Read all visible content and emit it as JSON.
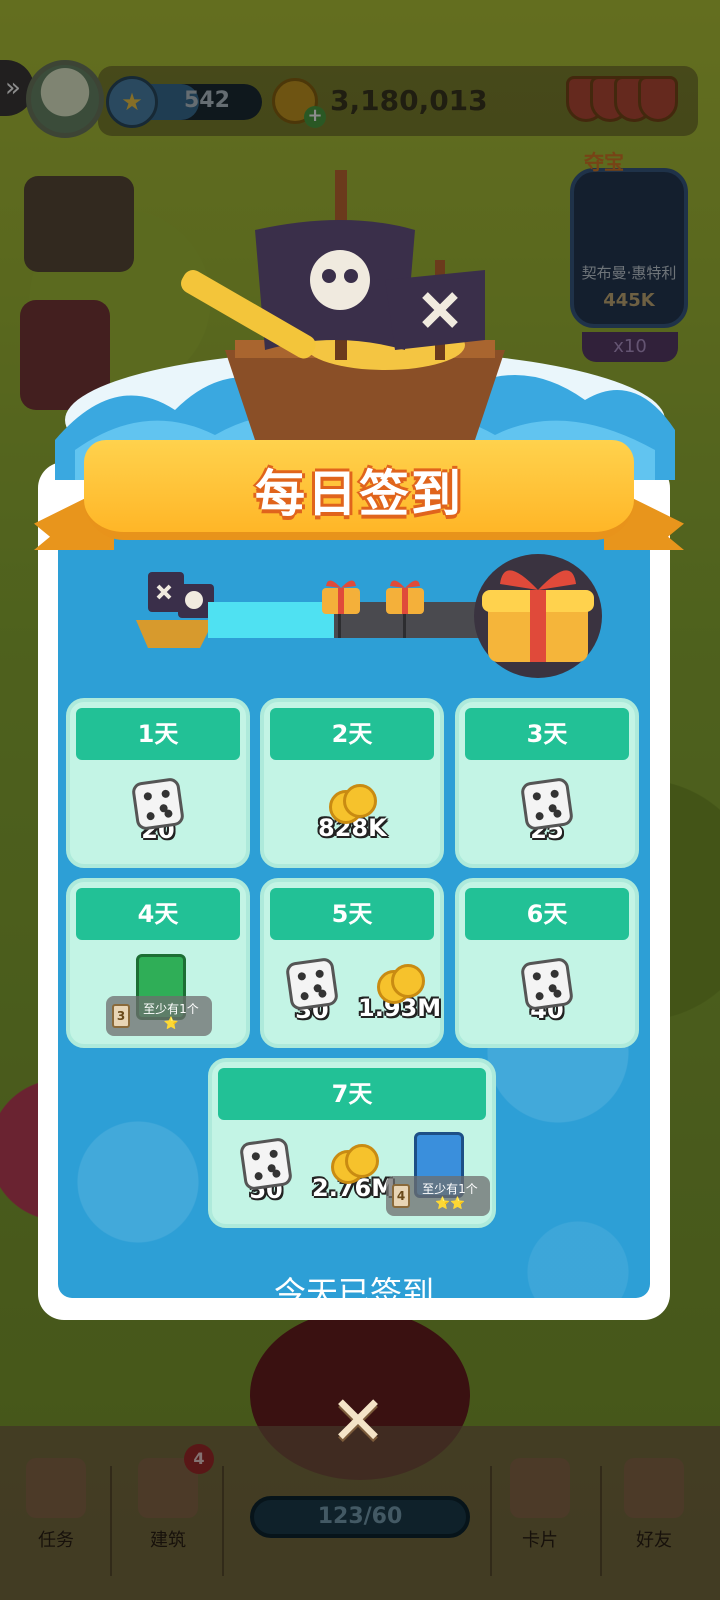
{
  "hud": {
    "level": "542",
    "coins": "3,180,013"
  },
  "side": {
    "right_title": "夺宝",
    "right_name": "契布曼·惠特利",
    "right_value": "445K",
    "right_multiplier": "x10"
  },
  "popup": {
    "title": "每日签到",
    "progress_fraction": 0.45,
    "days": [
      {
        "label": "1天",
        "rewards": [
          {
            "type": "dice",
            "amount": "20"
          }
        ]
      },
      {
        "label": "2天",
        "rewards": [
          {
            "type": "coins",
            "amount": "828K"
          }
        ]
      },
      {
        "label": "3天",
        "rewards": [
          {
            "type": "dice",
            "amount": "25"
          }
        ]
      },
      {
        "label": "4天",
        "rewards": [
          {
            "type": "card-pack",
            "pack_count": "3",
            "pack_text": "至少有1个",
            "stars": "⭐"
          }
        ]
      },
      {
        "label": "5天",
        "rewards": [
          {
            "type": "dice",
            "amount": "30"
          },
          {
            "type": "coins",
            "amount": "1.93M"
          }
        ]
      },
      {
        "label": "6天",
        "rewards": [
          {
            "type": "dice",
            "amount": "40"
          }
        ]
      },
      {
        "label": "7天",
        "rewards": [
          {
            "type": "dice",
            "amount": "50"
          },
          {
            "type": "coins",
            "amount": "2.76M"
          },
          {
            "type": "card-pack",
            "pack_count": "4",
            "pack_text": "至少有1个",
            "stars": "⭐⭐"
          }
        ]
      }
    ],
    "status": "今天已签到",
    "close_icon": "close-icon"
  },
  "bottom": {
    "go_counter": "123/60",
    "tabs": [
      {
        "label": "任务",
        "icon": "task-icon"
      },
      {
        "label": "建筑",
        "icon": "build-icon",
        "badge": "4"
      },
      {
        "label": "卡片",
        "icon": "card-icon"
      },
      {
        "label": "好友",
        "icon": "friends-icon"
      }
    ]
  },
  "colors": {
    "popup_blue": "#2d9fd6",
    "card_bg": "#c3f4e5",
    "card_head": "#22c196",
    "ribbon": "#ffb627",
    "progress_fill": "#4fe1f2"
  }
}
